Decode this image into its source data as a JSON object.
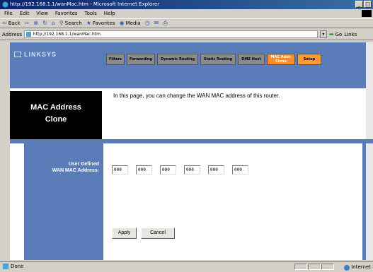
{
  "window": {
    "title": "http://192.168.1.1/wanMac.htm - Microsoft Internet Explorer",
    "controls": [
      "_",
      "□"
    ]
  },
  "menu": [
    "File",
    "Edit",
    "View",
    "Favorites",
    "Tools",
    "Help"
  ],
  "toolbar": {
    "back": "Back",
    "search": "Search",
    "favorites": "Favorites",
    "media": "Media"
  },
  "address": {
    "label": "Address",
    "url": "http://192.168.1.1/wanMac.htm",
    "go": "Go",
    "links": "Links"
  },
  "brand": {
    "name": "LINKSYS"
  },
  "tabs": [
    {
      "label": "Filters"
    },
    {
      "label": "Forwarding"
    },
    {
      "label": "Dynamic Routing"
    },
    {
      "label": "Static Routing"
    },
    {
      "label": "DMZ Host"
    },
    {
      "label": "MAC Addr. Clone"
    },
    {
      "label": "Setup"
    }
  ],
  "page": {
    "title_line1": "MAC Address",
    "title_line2": "Clone",
    "description": "In this page, you can change the WAN MAC address of this router.",
    "field_label_line1": "User Defined",
    "field_label_line2": "WAN MAC Address:",
    "mac_octets": [
      "000",
      "000",
      "000",
      "000",
      "000",
      "000"
    ]
  },
  "buttons": {
    "apply": "Apply",
    "cancel": "Cancel"
  },
  "status": {
    "done": "Done",
    "zone": "Internet"
  }
}
